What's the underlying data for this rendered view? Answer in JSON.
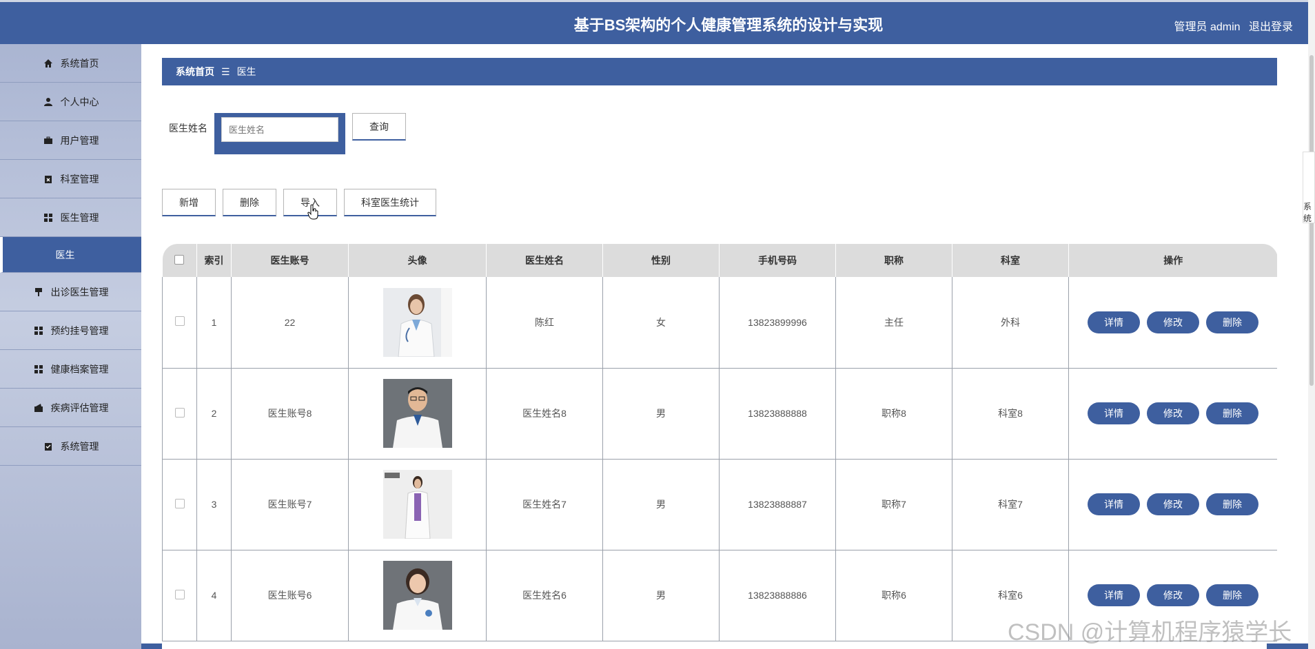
{
  "header": {
    "title": "基于BS架构的个人健康管理系统的设计与实现",
    "role": "管理员 admin",
    "logout": "退出登录"
  },
  "sidebar": {
    "items": [
      {
        "label": "系统首页",
        "icon": "home-icon"
      },
      {
        "label": "个人中心",
        "icon": "user-icon"
      },
      {
        "label": "用户管理",
        "icon": "briefcase-icon"
      },
      {
        "label": "科室管理",
        "icon": "clipboard-icon"
      },
      {
        "label": "医生管理",
        "icon": "grid-icon"
      },
      {
        "label": "医生",
        "icon": "",
        "active": true
      },
      {
        "label": "出诊医生管理",
        "icon": "stamp-icon"
      },
      {
        "label": "预约挂号管理",
        "icon": "grid-icon"
      },
      {
        "label": "健康档案管理",
        "icon": "grid-icon"
      },
      {
        "label": "疾病评估管理",
        "icon": "wallet-icon"
      },
      {
        "label": "系统管理",
        "icon": "checklist-icon"
      }
    ]
  },
  "breadcrumb": {
    "home": "系统首页",
    "sep": "☰",
    "current": "医生"
  },
  "search": {
    "label": "医生姓名",
    "placeholder": "医生姓名",
    "button": "查询"
  },
  "toolbar": {
    "add": "新增",
    "delete": "删除",
    "import": "导入",
    "stats": "科室医生统计"
  },
  "table": {
    "headers": [
      "索引",
      "医生账号",
      "头像",
      "医生姓名",
      "性别",
      "手机号码",
      "职称",
      "科室",
      "操作"
    ],
    "rows": [
      {
        "index": "1",
        "account": "22",
        "name": "陈红",
        "gender": "女",
        "phone": "13823899996",
        "title": "主任",
        "dept": "外科"
      },
      {
        "index": "2",
        "account": "医生账号8",
        "name": "医生姓名8",
        "gender": "男",
        "phone": "13823888888",
        "title": "职称8",
        "dept": "科室8"
      },
      {
        "index": "3",
        "account": "医生账号7",
        "name": "医生姓名7",
        "gender": "男",
        "phone": "13823888887",
        "title": "职称7",
        "dept": "科室7"
      },
      {
        "index": "4",
        "account": "医生账号6",
        "name": "医生姓名6",
        "gender": "男",
        "phone": "13823888886",
        "title": "职称6",
        "dept": "科室6"
      }
    ],
    "actions": {
      "detail": "详情",
      "edit": "修改",
      "remove": "删除"
    }
  },
  "watermark": "CSDN @计算机程序猿学长",
  "edge_tab": "系统",
  "colors": {
    "primary": "#3e5f9f",
    "sidebar": "#b3bdd7"
  }
}
